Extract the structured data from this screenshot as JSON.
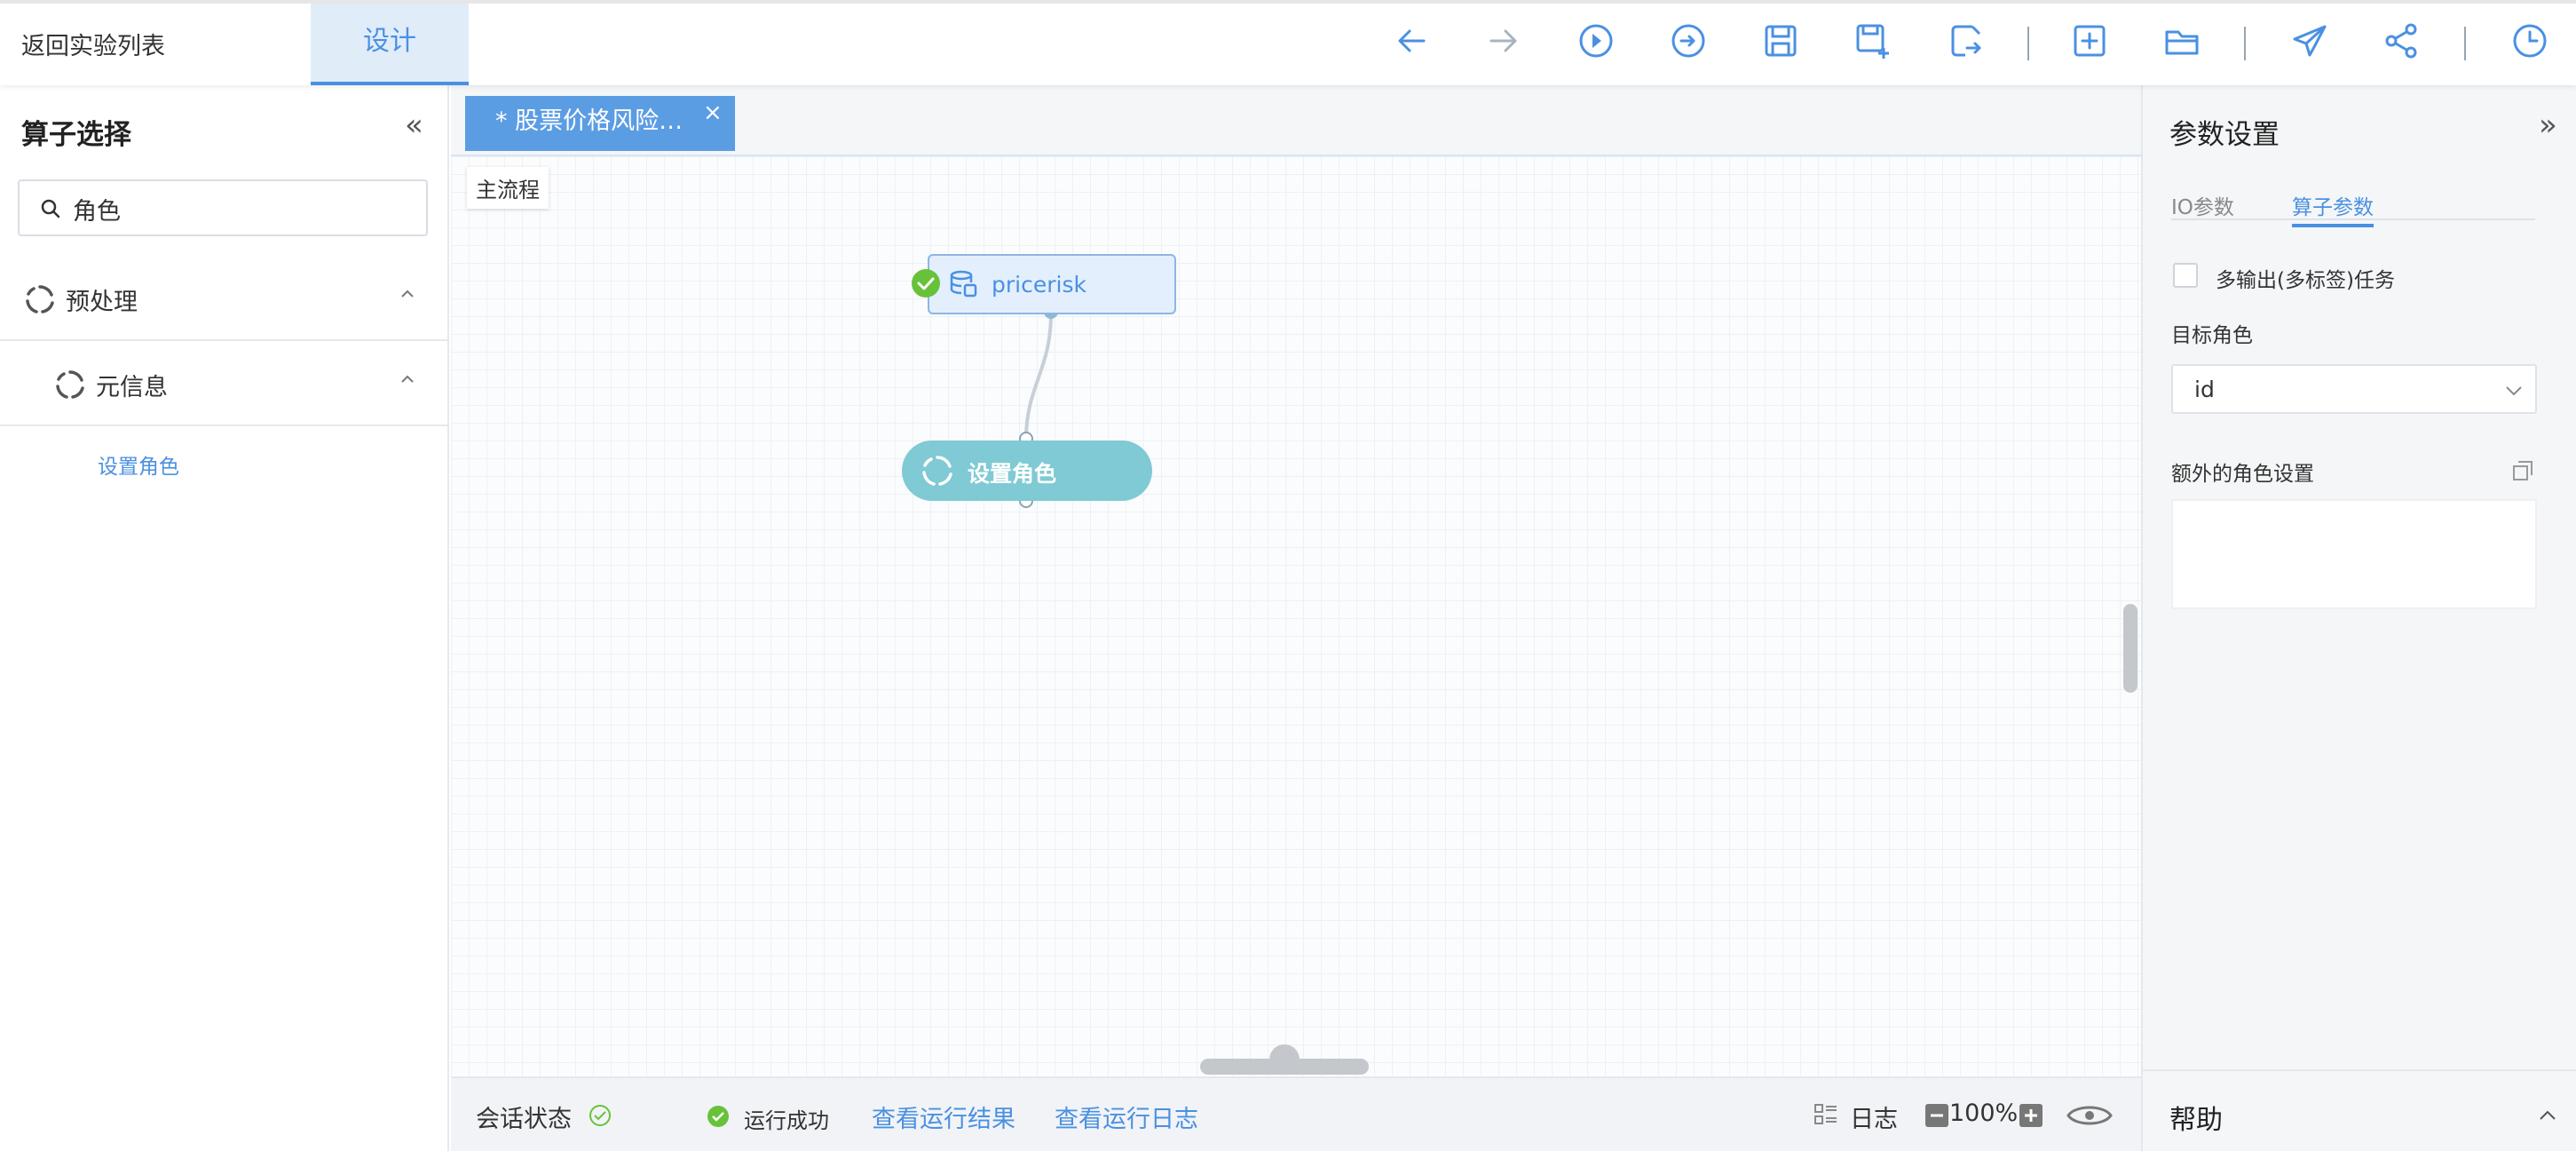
{
  "topbar": {
    "back_label": "返回实验列表",
    "design_tab": "设计"
  },
  "left": {
    "title": "算子选择",
    "collapse_glyph": "«",
    "search": {
      "value": "角色",
      "placeholder": ""
    },
    "tree": [
      {
        "label": "预处理"
      },
      {
        "label": "元信息"
      }
    ],
    "leaf": "设置角色"
  },
  "canvas": {
    "tab_title": "* 股票价格风险…",
    "tab_close": "×",
    "breadcrumb": "主流程",
    "nodes": {
      "source": "pricerisk",
      "operator": "设置角色"
    }
  },
  "statusbar": {
    "session_label": "会话状态",
    "run_status": "运行成功",
    "view_results": "查看运行结果",
    "view_logs": "查看运行日志",
    "log_label": "日志",
    "zoom": "100%"
  },
  "right": {
    "title": "参数设置",
    "collapse_glyph": "»",
    "tabs": {
      "io": "IO参数",
      "operator": "算子参数"
    },
    "multi_output_label": "多输出(多标签)任务",
    "multi_output_checked": false,
    "target_role_label": "目标角色",
    "target_role_value": "id",
    "extra_roles_label": "额外的角色设置",
    "help_title": "帮助"
  },
  "colors": {
    "accent": "#4a90e2",
    "tab_active_bg": "#5b9de3",
    "operator_node": "#7fcad4",
    "success": "#67c23a"
  }
}
